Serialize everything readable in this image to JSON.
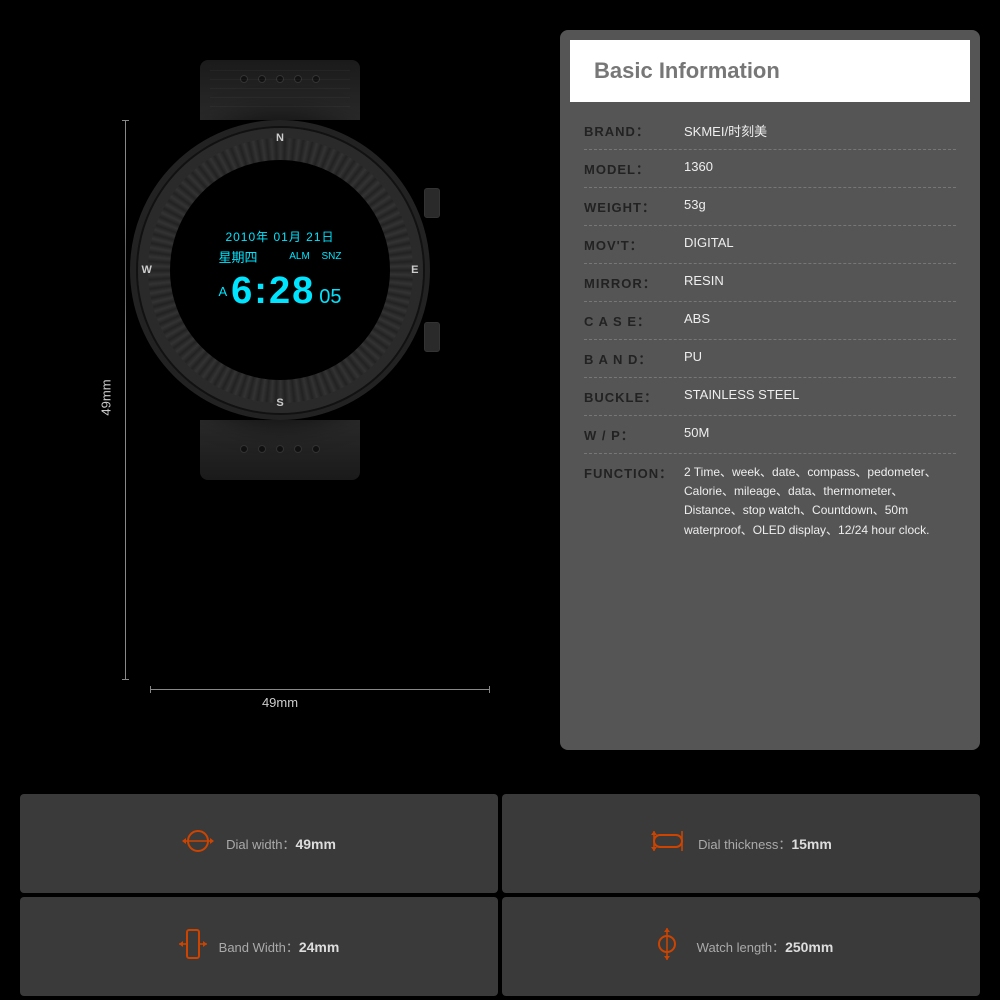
{
  "page": {
    "background": "#000000"
  },
  "watch": {
    "date": "2010年 01月 21日",
    "day": "星期四",
    "alm": "ALM",
    "snz": "SNZ",
    "a_label": "A",
    "time": "6:28",
    "seconds": "05",
    "dim_height": "49mm",
    "dim_width": "49mm"
  },
  "info": {
    "title": "Basic Information",
    "rows": [
      {
        "label": "BRAND：",
        "value": "SKMEI/时刻美"
      },
      {
        "label": "MODEL：",
        "value": "1360"
      },
      {
        "label": "WEIGHT：",
        "value": "53g"
      },
      {
        "label": "MOV'T：",
        "value": "DIGITAL"
      },
      {
        "label": "MIRROR：",
        "value": "RESIN"
      },
      {
        "label": "C A S E：",
        "value": "ABS"
      },
      {
        "label": "B A N D：",
        "value": "PU"
      },
      {
        "label": "BUCKLE：",
        "value": "STAINLESS STEEL"
      },
      {
        "label": "W / P：",
        "value": "50M"
      },
      {
        "label": "FUNCTION：",
        "value": "2 Time、week、date、compass、pedometer、Calorie、mileage、data、thermometer、Distance、stop watch、Countdown、50m waterproof、OLED display、12/24 hour clock."
      }
    ]
  },
  "measurements": [
    {
      "icon": "⊙",
      "label": "Dial width：",
      "value": "49mm"
    },
    {
      "icon": "⊟",
      "label": "Dial thickness：",
      "value": "15mm"
    },
    {
      "icon": "▯",
      "label": "Band Width：",
      "value": "24mm"
    },
    {
      "icon": "⊙",
      "label": "Watch length：",
      "value": "250mm"
    }
  ]
}
